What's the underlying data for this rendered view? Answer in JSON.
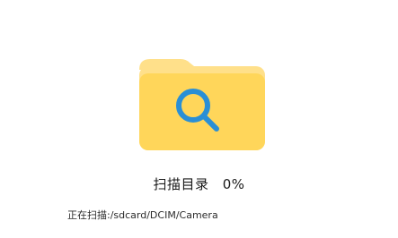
{
  "scan": {
    "title": "扫描目录",
    "progress": "0%",
    "current_path": "正在扫描:/sdcard/DCIM/Camera"
  },
  "illustration": {
    "icon": "folder-search-icon",
    "folder_color": "#FFD65A",
    "folder_tab_color": "#FFE08A",
    "magnifier_color": "#2A8FD6"
  }
}
